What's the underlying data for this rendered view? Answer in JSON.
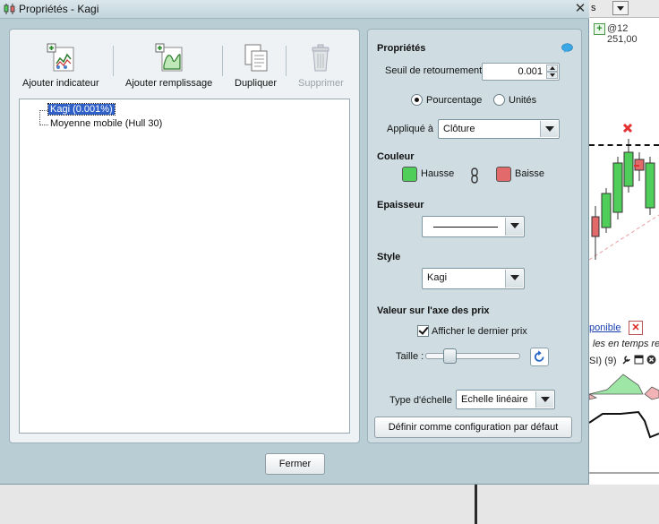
{
  "window": {
    "title": "Propriétés - Kagi",
    "close_glyph": "✕"
  },
  "toolbar": {
    "add_indicator": "Ajouter indicateur",
    "add_fill": "Ajouter remplissage",
    "duplicate": "Dupliquer",
    "delete": "Supprimer"
  },
  "tree": {
    "items": [
      {
        "label": "Kagi (0.001%)",
        "selected": true
      },
      {
        "label": "Moyenne mobile (Hull 30)",
        "selected": false
      }
    ]
  },
  "footer": {
    "close_label": "Fermer"
  },
  "properties": {
    "header": "Propriétés",
    "threshold": {
      "label": "Seuil de retournement",
      "value": "0.001"
    },
    "mode": {
      "percent_label": "Pourcentage",
      "units_label": "Unités",
      "selected": "percent"
    },
    "applied": {
      "label": "Appliqué à",
      "value": "Clôture"
    },
    "color": {
      "header": "Couleur",
      "up_label": "Hausse",
      "up_color": "#4fcf5a",
      "down_label": "Baisse",
      "down_color": "#e36a6a"
    },
    "thickness": {
      "header": "Epaisseur"
    },
    "style": {
      "header": "Style",
      "value": "Kagi"
    },
    "price_axis": {
      "header": "Valeur sur l'axe des prix",
      "show_last_label": "Afficher le dernier prix",
      "show_last_checked": true,
      "size_label": "Taille :",
      "size_level": 0.22
    },
    "scale": {
      "label": "Type d'échelle",
      "value": "Echelle linéaire"
    },
    "default_button": "Définir comme configuration par défaut"
  },
  "background_app": {
    "selector_text": "s",
    "price_text": "@12 251,00",
    "notice_text": "ponible",
    "realtime_text": "les en temps re",
    "rsi_text": "SI) (9)"
  }
}
